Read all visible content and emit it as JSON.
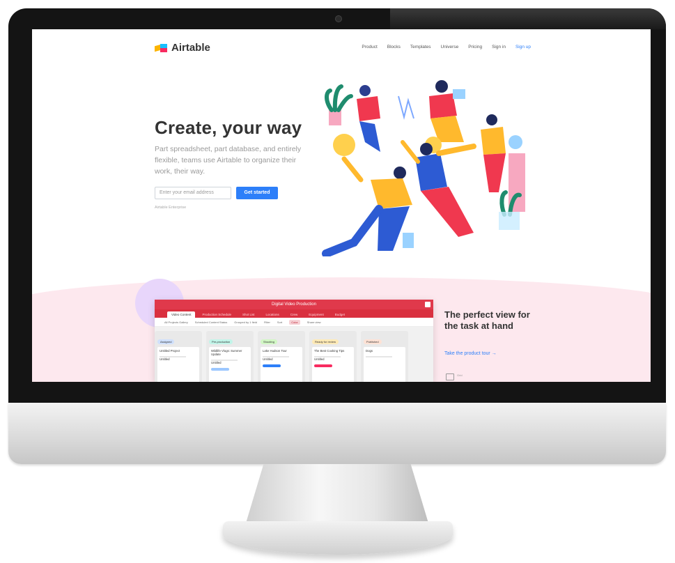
{
  "nav": {
    "logo_text": "Airtable",
    "links": [
      "Product",
      "Blocks",
      "Templates",
      "Universe",
      "Pricing",
      "Sign in",
      "Sign up"
    ]
  },
  "hero": {
    "title": "Create, your way",
    "subtitle": "Part spreadsheet, part database, and entirely flexible, teams use Airtable to organize their work, their way.",
    "email_placeholder": "Enter your email address",
    "cta_label": "Get started",
    "small_link": "Airtable Enterprise"
  },
  "app": {
    "title": "Digital Video Production",
    "tabs": [
      "Video Content",
      "Production Schedule",
      "Shot List",
      "Locations",
      "Crew",
      "Equipment",
      "Budget"
    ],
    "toolbar": [
      "All Projects Gallery",
      "Scheduled Content Status",
      "Grouped by 1 field",
      "Filter",
      "Sort",
      "Color",
      "Share view"
    ],
    "columns": [
      {
        "label": "Assigned",
        "color": "#cfe0fc",
        "card": "Untitled Project",
        "value": "Untitled",
        "tag": ""
      },
      {
        "label": "Pre-production",
        "color": "#c2f5e9",
        "card": "Wildlife Vlogs: Summer Update",
        "value": "Untitled",
        "tag": "#9cc7ff"
      },
      {
        "label": "Shooting",
        "color": "#d1f7c4",
        "card": "Lake Hudson Tour",
        "value": "Untitled",
        "tag": "#2d7ff9"
      },
      {
        "label": "Ready for review",
        "color": "#ffeab6",
        "card": "The Best Cooking Tips",
        "value": "Untitled",
        "tag": "#f82b60"
      },
      {
        "label": "Published",
        "color": "#fee2d5",
        "card": "Dogs",
        "value": "",
        "tag": ""
      }
    ]
  },
  "side": {
    "title": "The perfect view for the task at hand",
    "link": "Take the product tour →",
    "icon_label": "Grid"
  }
}
